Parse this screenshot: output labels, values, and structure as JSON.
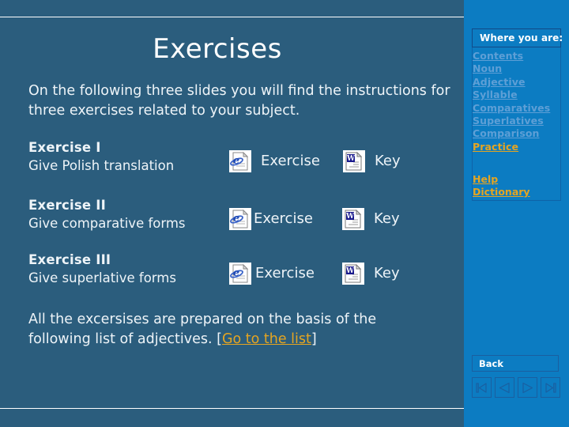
{
  "slide": {
    "title": "Exercises",
    "intro": "On the following three slides you will find the instructions for three exercises related to your subject.",
    "outro_before": "All the excersises are prepared on the basis of the following list of adjectives. [",
    "outro_link": "Go to the list",
    "outro_after": "]"
  },
  "exercises": [
    {
      "title": "Exercise I",
      "subtitle": "Give Polish translation",
      "exercise_label": "Exercise",
      "key_label": "Key",
      "exercise_icon": "internet-explorer-document-icon",
      "key_icon": "word-document-icon"
    },
    {
      "title": "Exercise II",
      "subtitle": "Give comparative forms",
      "exercise_label": "Exercise",
      "key_label": "Key",
      "exercise_icon": "internet-explorer-document-icon",
      "key_icon": "word-document-icon"
    },
    {
      "title": "Exercise III",
      "subtitle": "Give superlative forms",
      "exercise_label": "Exercise",
      "key_label": "Key",
      "exercise_icon": "internet-explorer-document-icon",
      "key_icon": "word-document-icon"
    }
  ],
  "sidebar": {
    "header": "Where you are:",
    "nav_items": [
      {
        "label": "Contents",
        "active": false
      },
      {
        "label": "Noun",
        "active": false
      },
      {
        "label": "Adjective",
        "active": false
      },
      {
        "label": "Syllable",
        "active": false
      },
      {
        "label": "Comparatives",
        "active": false
      },
      {
        "label": "Superlatives",
        "active": false
      },
      {
        "label": "Comparison",
        "active": false
      },
      {
        "label": "Practice",
        "active": true
      }
    ],
    "aux_items": [
      {
        "label": "Help"
      },
      {
        "label": "Dictionary"
      }
    ],
    "back_label": "Back",
    "nav_buttons": [
      {
        "name": "first-slide-button",
        "icon": "first-icon"
      },
      {
        "name": "previous-slide-button",
        "icon": "previous-icon"
      },
      {
        "name": "next-slide-button",
        "icon": "next-icon"
      },
      {
        "name": "last-slide-button",
        "icon": "last-icon"
      }
    ]
  },
  "colors": {
    "background": "#2b5d7d",
    "sidebar": "#0c7cc2",
    "accent": "#e5a521",
    "nav_inactive": "#5e9fd6",
    "text": "#eef4f8"
  }
}
